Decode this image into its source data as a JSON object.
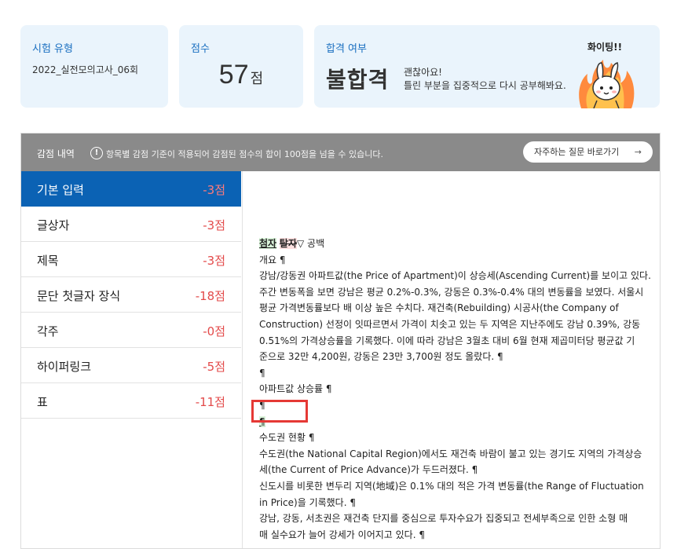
{
  "summary": {
    "type_label": "시험 유형",
    "type_value": "2022_실전모의고사_06회",
    "score_label": "점수",
    "score_value": "57",
    "score_unit": "점",
    "pass_label": "합격 여부",
    "pass_value": "불합격",
    "pass_msg_1": "괜찮아요!",
    "pass_msg_2": "틀린 부분을 집중적으로 다시 공부해봐요.",
    "mascot_text": "화이팅!!"
  },
  "deduction": {
    "title": "감점 내역",
    "notice": "항목별 감점 기준이 적용되어 감점된 점수의 합이 100점을 넘을 수 있습니다.",
    "faq_label": "자주하는 질문 바로가기",
    "items": [
      {
        "label": "기본 입력",
        "points": "-3점"
      },
      {
        "label": "글상자",
        "points": "-3점"
      },
      {
        "label": "제목",
        "points": "-3점"
      },
      {
        "label": "문단 첫글자 장식",
        "points": "-18점"
      },
      {
        "label": "각주",
        "points": "-0점"
      },
      {
        "label": "하이퍼링크",
        "points": "-5점"
      },
      {
        "label": "표",
        "points": "-11점"
      }
    ]
  },
  "document": {
    "legend_insert": "첨자",
    "legend_delete": "탈자",
    "legend_space": "▽ 공백",
    "lines": [
      "개요 ¶",
      "강남/강동권 아파트값(the Price of Apartment)이 상승세(Ascending Current)를 보이고 있다.",
      "주간 변동폭을 보면 강남은 평균 0.2%-0.3%, 강동은 0.3%-0.4% 대의 변동률을 보였다. 서울시",
      "평균 가격변동률보다 배 이상 높은 수치다. 재건축(Rebuilding) 시공사(the Company of",
      "Construction) 선정이 잇따르면서 가격이 치솟고 있는 두 지역은 지난주에도 강남 0.39%, 강동",
      "0.51%의 가격상승률을 기록했다. 이에 따라 강남은 3월초 대비 6월 현재 제곱미터당 평균값 기",
      "준으로 32만 4,200원, 강동은 23만 3,700원 정도 올랐다. ¶",
      " ¶",
      "아파트값 상승률 ¶",
      " ¶",
      "¶",
      "수도권 현황 ¶",
      "수도권(the National Capital Region)에서도 재건축 바람이 불고 있는 경기도 지역의 가격상승",
      "세(the Current of Price Advance)가 두드러졌다. ¶",
      "신도시를 비롯한 변두리 지역(地域)은 0.1% 대의 적은 가격 변동률(the Range of Fluctuation",
      "in Price)을 기록했다. ¶",
      "강남, 강동, 서초권은 재건축 단지를 중심으로 투자수요가 집중되고 전세부족으로 인한 소형 매",
      "매 실수요가 늘어 강세가 이어지고 있다. ¶"
    ]
  }
}
